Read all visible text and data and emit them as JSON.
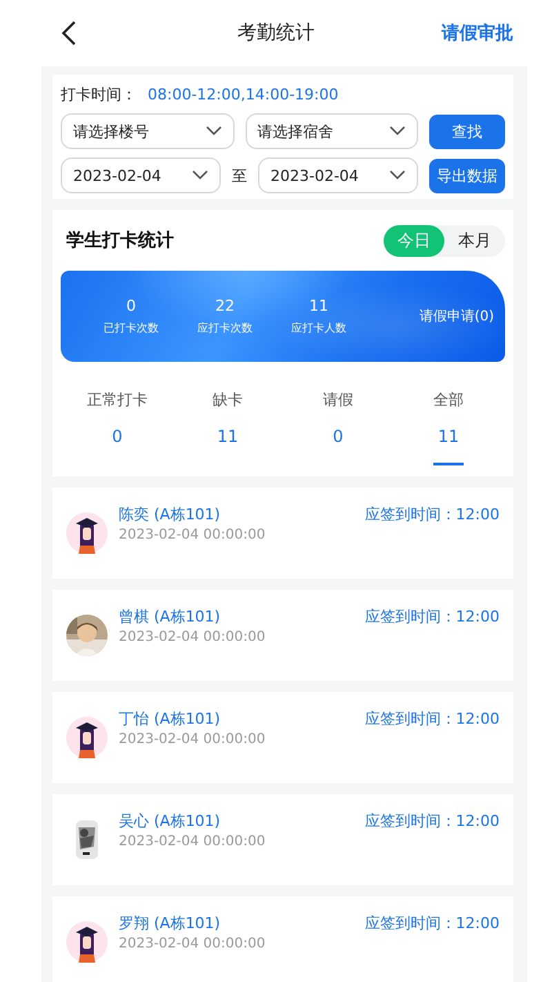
{
  "header": {
    "title": "考勤统计",
    "action": "请假审批"
  },
  "filters": {
    "time_label": "打卡时间：",
    "time_value": "08:00-12:00,14:00-19:00",
    "building": {
      "placeholder": "请选择楼号"
    },
    "dorm": {
      "placeholder": "请选择宿舍"
    },
    "search_button": "查找",
    "date_from": "2023-02-04",
    "date_sep": "至",
    "date_to": "2023-02-04",
    "export_button": "导出数据"
  },
  "stats": {
    "title": "学生打卡统计",
    "periods": [
      {
        "label": "今日",
        "selected": true
      },
      {
        "label": "本月",
        "selected": false
      }
    ],
    "summary": [
      {
        "value": "0",
        "label": "已打卡次数"
      },
      {
        "value": "22",
        "label": "应打卡次数"
      },
      {
        "value": "11",
        "label": "应打卡人数"
      }
    ],
    "leave_request": "请假申请(0)",
    "tabs": [
      {
        "label": "正常打卡",
        "count": "0",
        "selected": false
      },
      {
        "label": "缺卡",
        "count": "11",
        "selected": false
      },
      {
        "label": "请假",
        "count": "0",
        "selected": false
      },
      {
        "label": "全部",
        "count": "11",
        "selected": true
      }
    ]
  },
  "students": [
    {
      "kind": "avatar",
      "name": "陈奕 (A栋101)",
      "time": "2023-02-04 00:00:00",
      "due": "应签到时间：12:00"
    },
    {
      "kind": "picture",
      "name": "曾棋 (A栋101)",
      "time": "2023-02-04 00:00:00",
      "due": "应签到时间：12:00"
    },
    {
      "kind": "avatar",
      "name": "丁怡 (A栋101)",
      "time": "2023-02-04 00:00:00",
      "due": "应签到时间：12:00"
    },
    {
      "kind": "picture",
      "name": "吴心 (A栋101)",
      "time": "2023-02-04 00:00:00",
      "due": "应签到时间：12:00"
    },
    {
      "kind": "avatar",
      "name": "罗翔 (A栋101)",
      "time": "2023-02-04 00:00:00",
      "due": "应签到时间：12:00"
    }
  ]
}
